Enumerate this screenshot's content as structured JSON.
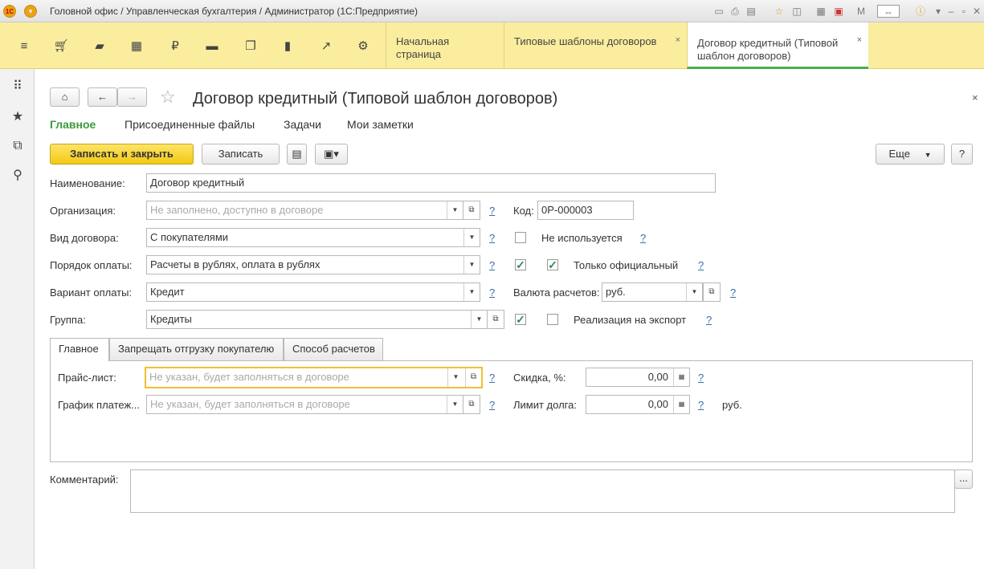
{
  "titlebar": {
    "title": "Головной офис / Управленческая бухгалтерия / Администратор  (1С:Предприятие)",
    "logo": "1С",
    "right_text": "M"
  },
  "sections": {
    "icons": [
      "menu-icon",
      "cart-icon",
      "bag-icon",
      "grid-icon",
      "ruble-icon",
      "truck-icon",
      "docs-icon",
      "bar-chart-icon",
      "trend-icon",
      "gear-icon"
    ]
  },
  "tabs": [
    {
      "label": "Начальная страница"
    },
    {
      "label": "Типовые шаблоны договоров",
      "close": "×"
    },
    {
      "label": "Договор кредитный (Типовой шаблон договоров)",
      "close": "×"
    }
  ],
  "form": {
    "title": "Договор кредитный (Типовой шаблон договоров)",
    "close": "×",
    "nav": [
      "Главное",
      "Присоединенные файлы",
      "Задачи",
      "Мои заметки"
    ],
    "toolbar": {
      "save_close": "Записать и закрыть",
      "save": "Записать",
      "more": "Еще",
      "help": "?"
    },
    "fields": {
      "name_label": "Наименование:",
      "name_value": "Договор кредитный",
      "org_label": "Организация:",
      "org_placeholder": "Не заполнено, доступно в договоре",
      "code_label": "Код:",
      "code_value": "0Р-000003",
      "kind_label": "Вид договора:",
      "kind_value": "С покупателями",
      "not_used_label": "Не используется",
      "payorder_label": "Порядок оплаты:",
      "payorder_value": "Расчеты в рублях, оплата в рублях",
      "official_only_label": "Только официальный",
      "payvariant_label": "Вариант оплаты:",
      "payvariant_value": "Кредит",
      "currency_label": "Валюта расчетов:",
      "currency_value": "руб.",
      "group_label": "Группа:",
      "group_value": "Кредиты",
      "export_label": "Реализация на экспорт",
      "help_mark": "?"
    },
    "subtabs": [
      "Главное",
      "Запрещать отгрузку покупателю",
      "Способ расчетов"
    ],
    "main_tab": {
      "pricelist_label": "Прайс-лист:",
      "pricelist_placeholder": "Не указан, будет заполняться в договоре",
      "schedule_label": "График платеж...",
      "schedule_placeholder": "Не указан, будет заполняться в договоре",
      "discount_label": "Скидка, %:",
      "discount_value": "0,00",
      "debt_label": "Лимит долга:",
      "debt_value": "0,00",
      "debt_unit": "руб."
    },
    "comment_label": "Комментарий:",
    "comment_more": "..."
  }
}
